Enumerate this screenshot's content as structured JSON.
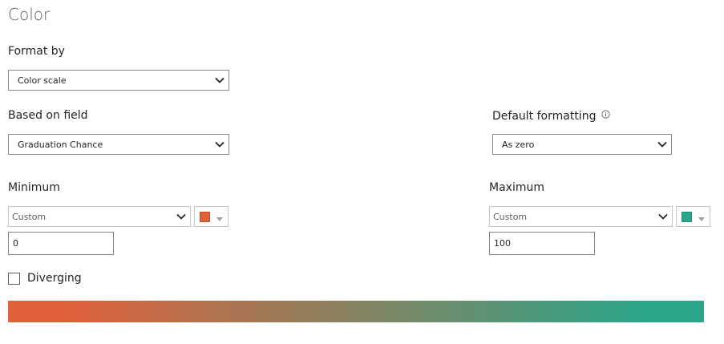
{
  "title": "Color",
  "format_by": {
    "label": "Format by",
    "value": "Color scale"
  },
  "based_on_field": {
    "label": "Based on field",
    "value": "Graduation Chance"
  },
  "default_formatting": {
    "label": "Default formatting",
    "value": "As zero",
    "info_icon": "info-icon"
  },
  "minimum": {
    "label": "Minimum",
    "type": "Custom",
    "value": "0",
    "color": "#E0603A"
  },
  "maximum": {
    "label": "Maximum",
    "type": "Custom",
    "value": "100",
    "color": "#2BA68A"
  },
  "diverging": {
    "label": "Diverging",
    "checked": false
  },
  "scale": {
    "start_color": "#E0603A",
    "end_color": "#2BA68A"
  }
}
